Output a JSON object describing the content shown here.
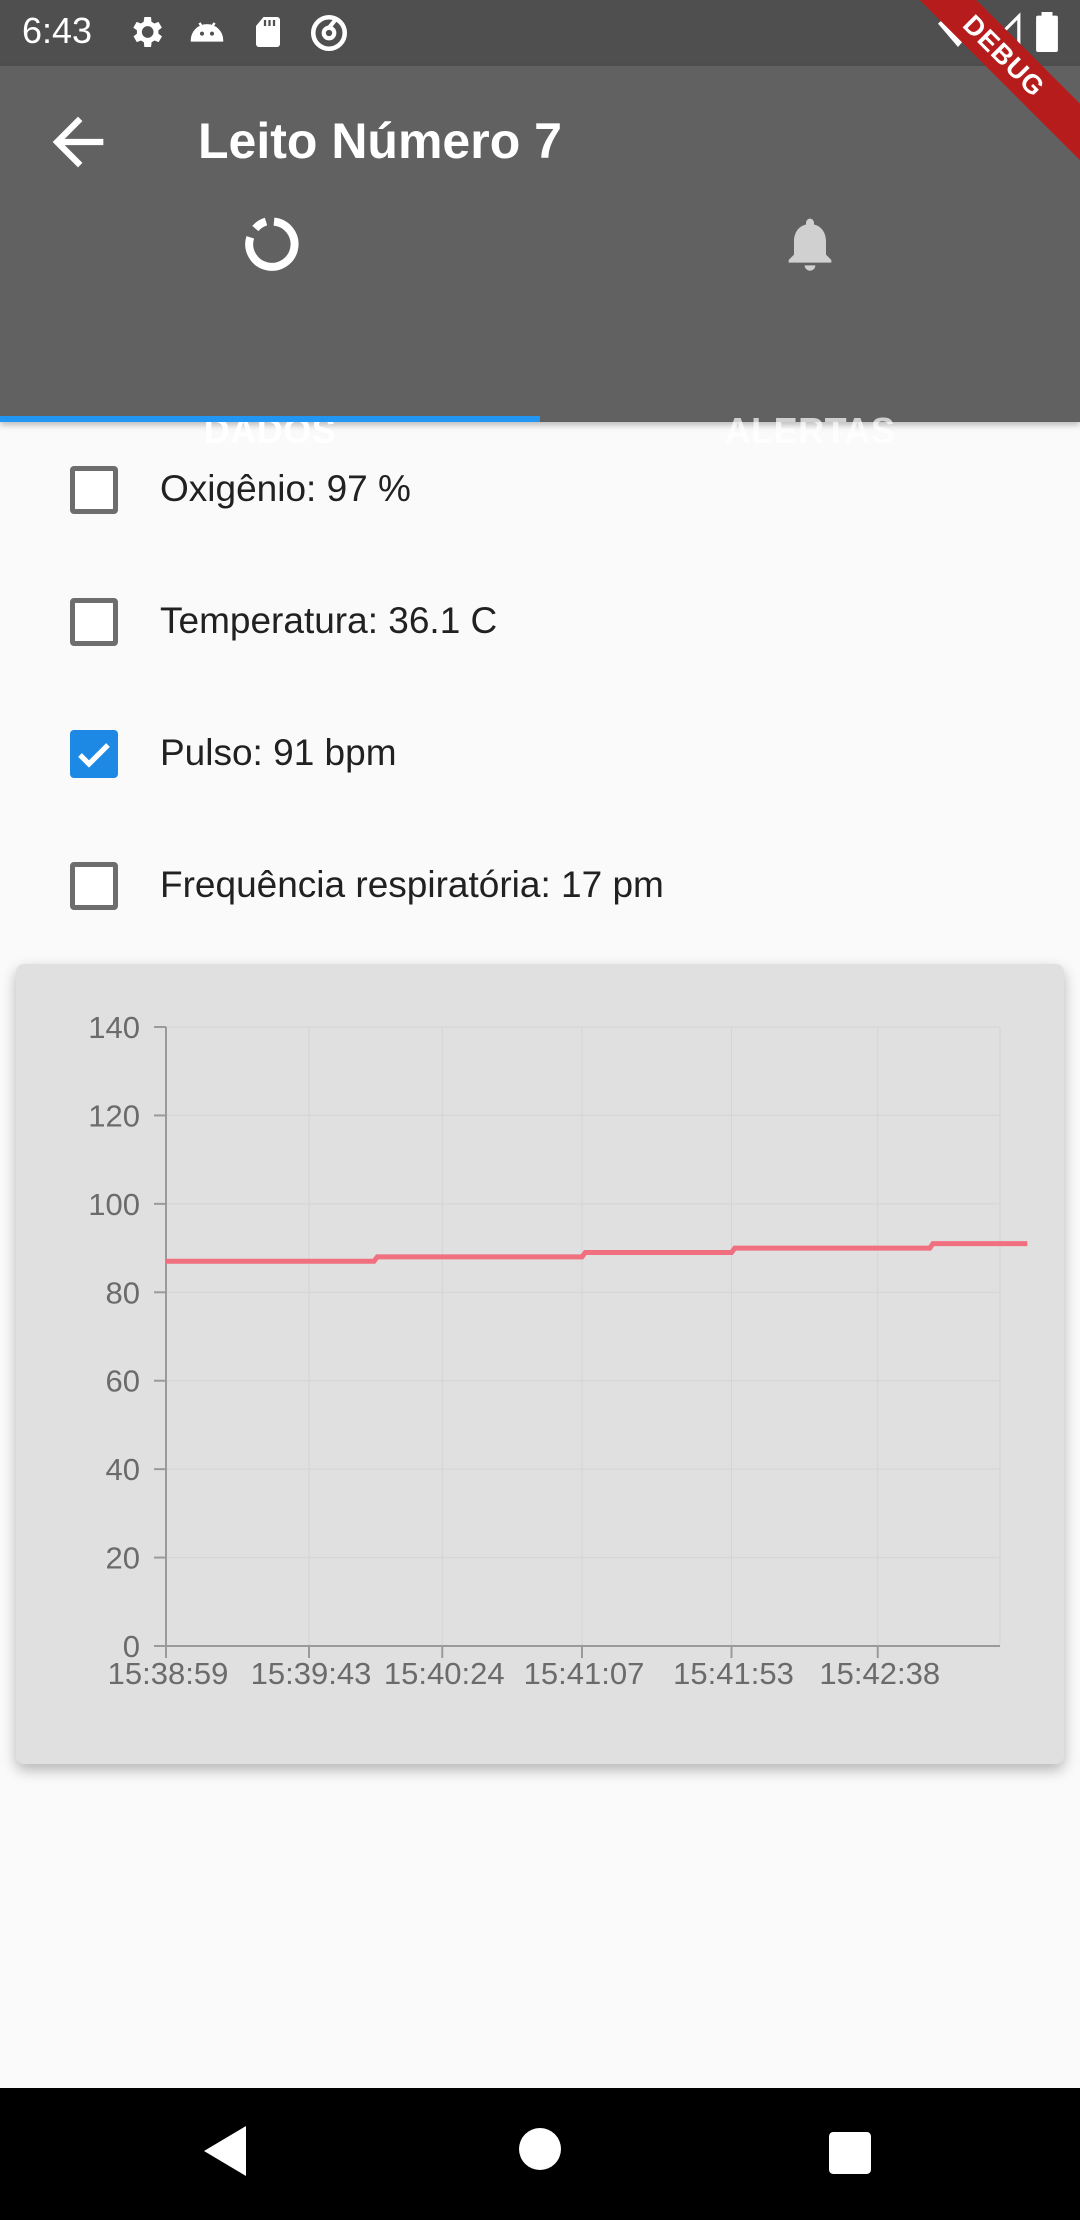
{
  "status_bar": {
    "time": "6:43",
    "icons": [
      "settings-icon",
      "android-icon",
      "sd-card-icon",
      "sync-icon",
      "wifi-icon",
      "signal-icon",
      "battery-icon"
    ]
  },
  "debug_banner": "DEBUG",
  "app_bar": {
    "back_icon": "arrow-back-icon",
    "title": "Leito Número 7"
  },
  "tabs": [
    {
      "label": "DADOS",
      "icon": "progress-circle-icon",
      "selected": true
    },
    {
      "label": "ALERTAS",
      "icon": "bell-icon",
      "selected": false
    }
  ],
  "readings": [
    {
      "label": "Oxigênio: 97 %",
      "checked": false
    },
    {
      "label": "Temperatura: 36.1 C",
      "checked": false
    },
    {
      "label": "Pulso: 91 bpm",
      "checked": true
    },
    {
      "label": "Frequência respiratória: 17 pm",
      "checked": false
    }
  ],
  "colors": {
    "app_bar": "#616161",
    "accent": "#2196f3",
    "checkbox_checked": "#1e88e5",
    "series_line": "#f07080",
    "chart_background": "#e0e0e0"
  },
  "chart_data": {
    "type": "line",
    "series": [
      {
        "x": [
          "15:38:59",
          "15:40:03",
          "15:40:04",
          "15:41:07",
          "15:41:08",
          "15:41:53",
          "15:41:54",
          "15:42:54",
          "15:42:55",
          "15:43:24"
        ],
        "values": [
          87,
          87,
          88,
          88,
          89,
          89,
          90,
          90,
          91,
          91
        ]
      }
    ],
    "x_tick_labels": [
      "15:38:59",
      "15:39:43",
      "15:40:24",
      "15:41:07",
      "15:41:53",
      "15:42:38"
    ],
    "y_ticks": [
      0,
      20,
      40,
      60,
      80,
      100,
      120,
      140
    ],
    "ylim": [
      0,
      140
    ],
    "grid": true,
    "legend": "none"
  },
  "nav_bar": [
    "back-triangle-icon",
    "home-circle-icon",
    "recents-square-icon"
  ]
}
